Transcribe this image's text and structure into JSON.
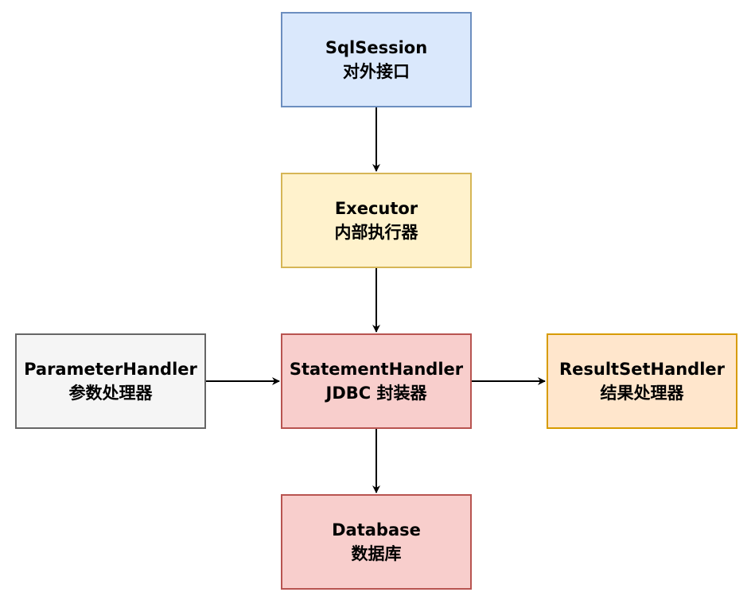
{
  "colors": {
    "background": "#ffffff",
    "edge": "#000000",
    "blue_fill": "#dae8fc",
    "blue_border": "#6c8ebf",
    "yellow_fill": "#fff2cc",
    "yellow_border": "#d6b656",
    "red_fill": "#f8cecc",
    "red_border": "#b85450",
    "gray_fill": "#f5f5f5",
    "gray_border": "#666666",
    "orange_fill": "#ffe6cc",
    "orange_border": "#d79b00"
  },
  "nodes": [
    {
      "id": "sqlsession",
      "line1": "SqlSession",
      "line2": "对外接口",
      "fill": "#dae8fc",
      "stroke": "#6c8ebf"
    },
    {
      "id": "executor",
      "line1": "Executor",
      "line2": "内部执行器",
      "fill": "#fff2cc",
      "stroke": "#d6b656"
    },
    {
      "id": "statement",
      "line1": "StatementHandler",
      "line2": "JDBC 封装器",
      "fill": "#f8cecc",
      "stroke": "#b85450"
    },
    {
      "id": "parameter",
      "line1": "ParameterHandler",
      "line2": "参数处理器",
      "fill": "#f5f5f5",
      "stroke": "#666666"
    },
    {
      "id": "resultset",
      "line1": "ResultSetHandler",
      "line2": "结果处理器",
      "fill": "#ffe6cc",
      "stroke": "#d79b00"
    },
    {
      "id": "database",
      "line1": "Database",
      "line2": "数据库",
      "fill": "#f8cecc",
      "stroke": "#b85450"
    }
  ],
  "edges": [
    {
      "from": "sqlsession",
      "to": "executor"
    },
    {
      "from": "executor",
      "to": "statement"
    },
    {
      "from": "parameter",
      "to": "statement"
    },
    {
      "from": "statement",
      "to": "resultset"
    },
    {
      "from": "statement",
      "to": "database"
    }
  ]
}
